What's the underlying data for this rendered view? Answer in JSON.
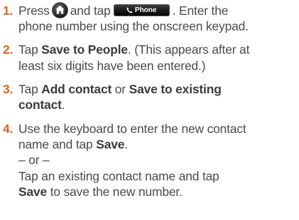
{
  "steps": [
    {
      "number": "1.",
      "line1_a": "Press",
      "line1_b": "and tap",
      "phone_button_label": "Phone",
      "line1_c": ". Enter the",
      "line2": "phone number using the onscreen keypad."
    },
    {
      "number": "2.",
      "line1_a": "Tap ",
      "line1_bold": "Save to People",
      "line1_c": ". (This appears after at",
      "line2": "least six digits have been entered.)"
    },
    {
      "number": "3.",
      "line1_a": "Tap ",
      "line1_bold_a": "Add contact",
      "line1_b": " or ",
      "line1_bold_b": "Save to existing",
      "line2_bold": "contact",
      "line2_end": "."
    },
    {
      "number": "4.",
      "line1": "Use the keyboard to enter the new contact",
      "line2_a": "name and tap ",
      "line2_bold": "Save",
      "line2_end": ".",
      "or_text": "– or –",
      "line4": "Tap an existing contact name and tap",
      "line5_bold": "Save",
      "line5_end": " to save the new number."
    }
  ],
  "icons": {
    "home": "home-icon",
    "phone": "phone-handset-icon"
  },
  "colors": {
    "step_number": "#e4611c",
    "body_text": "#4a4a4a",
    "button_bg": "#1b1b1b"
  }
}
